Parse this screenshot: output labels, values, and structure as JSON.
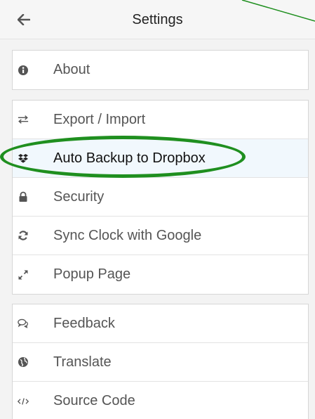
{
  "header": {
    "title": "Settings",
    "back_icon": "arrow-left-icon"
  },
  "groups": [
    {
      "items": [
        {
          "label": "About",
          "icon": "info-circle-icon"
        }
      ]
    },
    {
      "items": [
        {
          "label": "Export / Import",
          "icon": "exchange-icon"
        },
        {
          "label": "Auto Backup to Dropbox",
          "icon": "dropbox-icon",
          "selected": true
        },
        {
          "label": "Security",
          "icon": "lock-icon"
        },
        {
          "label": "Sync Clock with Google",
          "icon": "refresh-icon"
        },
        {
          "label": "Popup Page",
          "icon": "expand-icon"
        }
      ]
    },
    {
      "items": [
        {
          "label": "Feedback",
          "icon": "comments-icon"
        },
        {
          "label": "Translate",
          "icon": "globe-icon"
        },
        {
          "label": "Source Code",
          "icon": "code-icon"
        }
      ]
    }
  ],
  "colors": {
    "header_bg": "#f6f6f6",
    "content_bg": "#f3f3f3",
    "active_row_bg": "#f1f8fd",
    "annotation_green": "#1f8f1f",
    "icon_color": "#555555"
  }
}
